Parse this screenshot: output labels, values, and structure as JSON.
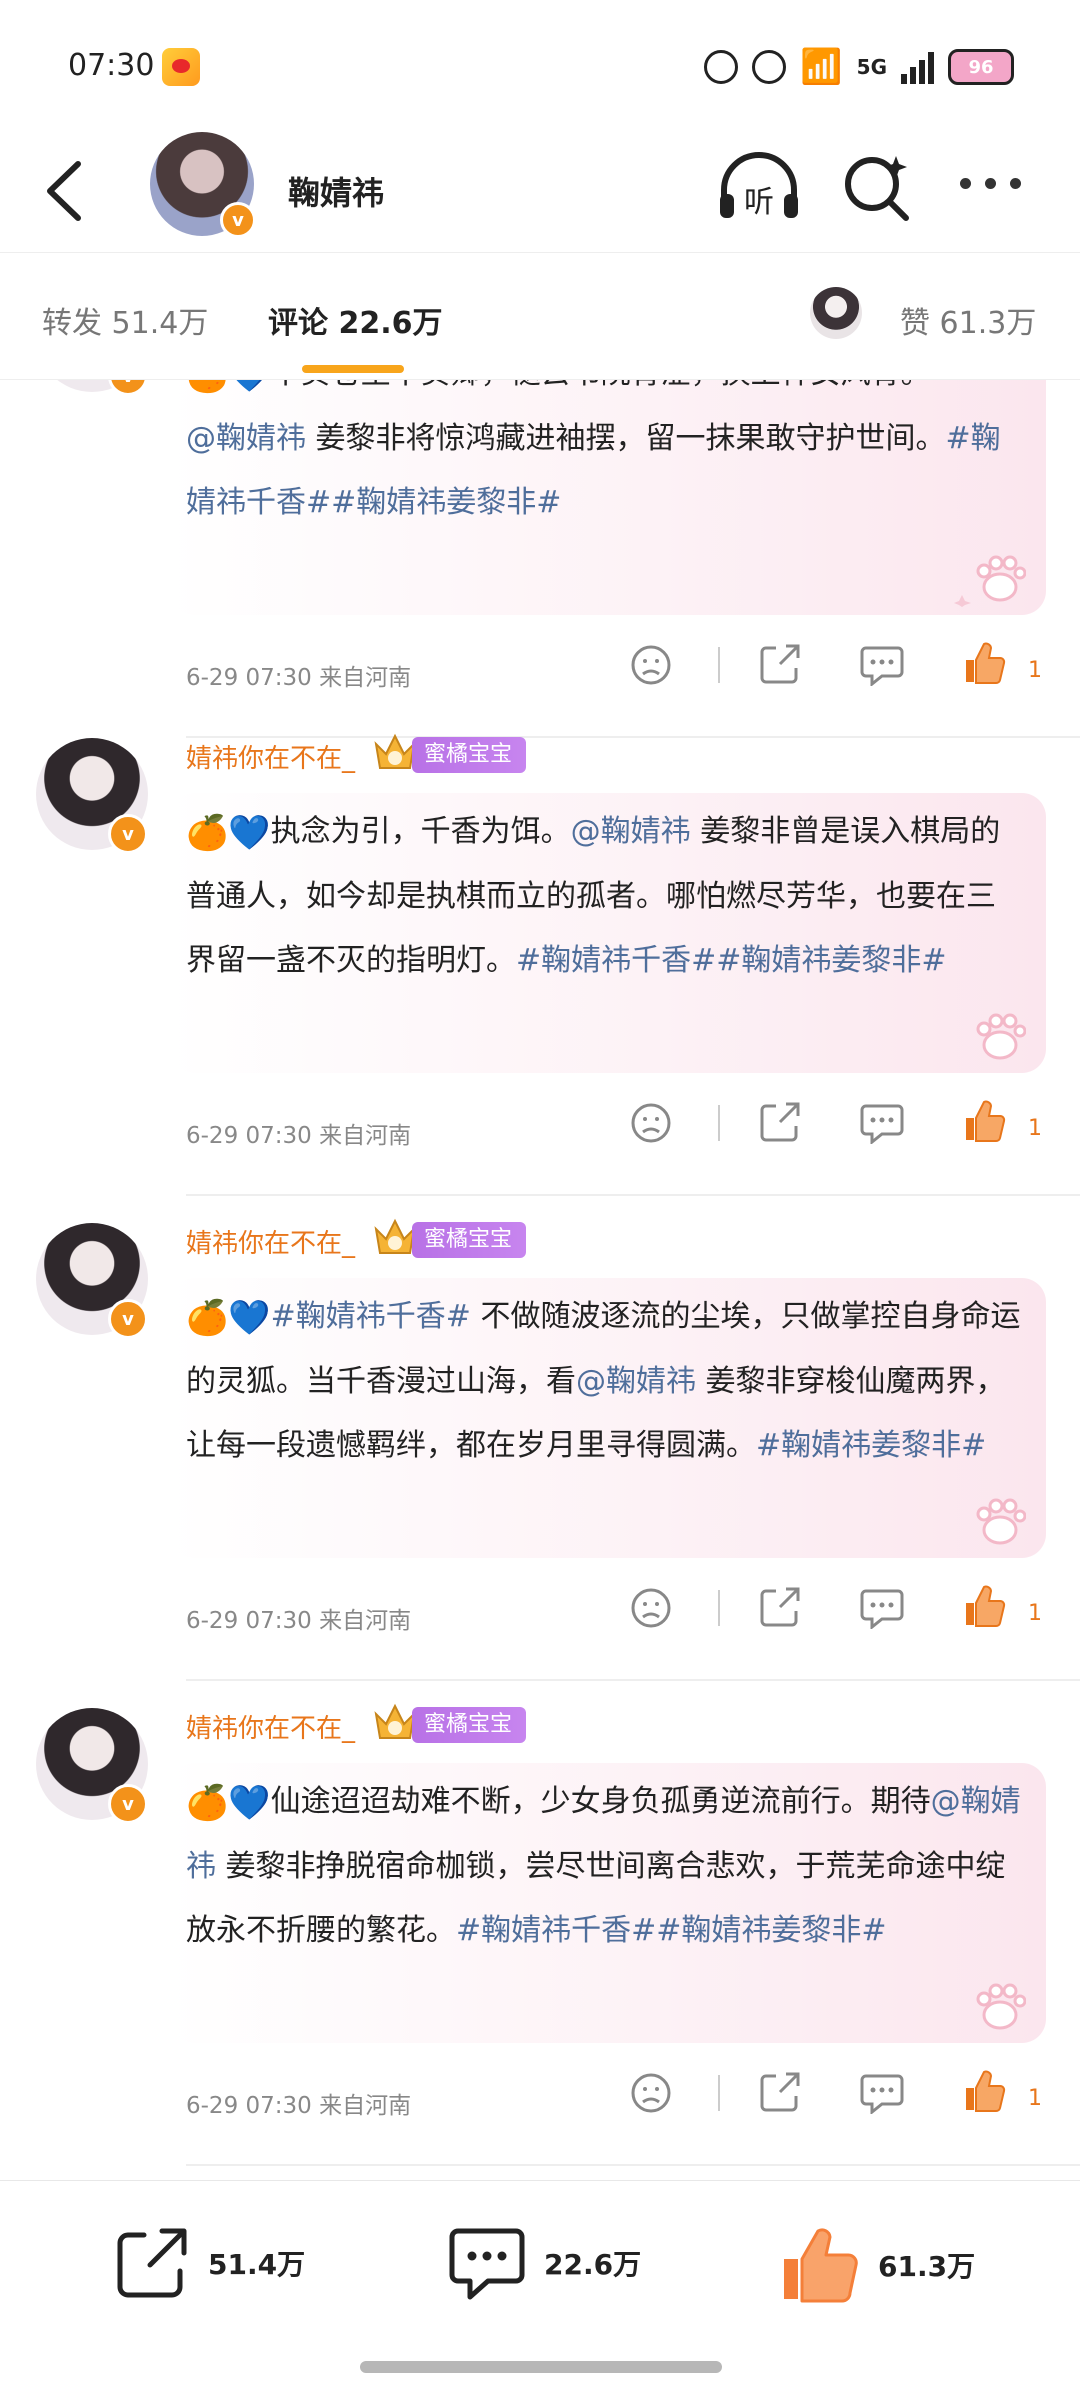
{
  "status": {
    "time": "07:30",
    "network": "5G",
    "battery": "96"
  },
  "header": {
    "name": "鞠婧祎",
    "listen_label": "听"
  },
  "tabs": {
    "repost": "转发 51.4万",
    "comment": "评论 22.6万",
    "like": "赞 61.3万"
  },
  "comments": [
    {
      "user": "",
      "tag": "",
      "emoji": "🍊💙",
      "parts": [
        {
          "text": "不负苍生不负卿，褪去书院青涩，换上神女风骨。",
          "link": false
        },
        {
          "text": "@鞠婧祎",
          "link": true
        },
        {
          "text": " 姜黎非将惊鸿藏进袖摆，留一抹果敢守护世间。",
          "link": false
        },
        {
          "text": "#鞠婧祎千香##鞠婧祎姜黎非#",
          "link": true
        }
      ],
      "time": "6-29 07:30",
      "location": "来自河南",
      "likes": "1"
    },
    {
      "user": "婧祎你在不在_",
      "tag": "蜜橘宝宝",
      "emoji": "🍊💙",
      "parts": [
        {
          "text": "执念为引，千香为饵。",
          "link": false
        },
        {
          "text": "@鞠婧祎",
          "link": true
        },
        {
          "text": " 姜黎非曾是误入棋局的普通人，如今却是执棋而立的孤者。哪怕燃尽芳华，也要在三界留一盏不灭的指明灯。",
          "link": false
        },
        {
          "text": "#鞠婧祎千香##鞠婧祎姜黎非#",
          "link": true
        }
      ],
      "time": "6-29 07:30",
      "location": "来自河南",
      "likes": "1"
    },
    {
      "user": "婧祎你在不在_",
      "tag": "蜜橘宝宝",
      "emoji": "🍊💙",
      "parts": [
        {
          "text": "#鞠婧祎千香#",
          "link": true
        },
        {
          "text": " 不做随波逐流的尘埃，只做掌控自身命运的灵狐。当千香漫过山海，看",
          "link": false
        },
        {
          "text": "@鞠婧祎",
          "link": true
        },
        {
          "text": " 姜黎非穿梭仙魔两界，让每一段遗憾羁绊，都在岁月里寻得圆满。",
          "link": false
        },
        {
          "text": "#鞠婧祎姜黎非#",
          "link": true
        }
      ],
      "time": "6-29 07:30",
      "location": "来自河南",
      "likes": "1"
    },
    {
      "user": "婧祎你在不在_",
      "tag": "蜜橘宝宝",
      "emoji": "🍊💙",
      "parts": [
        {
          "text": "仙途迢迢劫难不断，少女身负孤勇逆流前行。期待",
          "link": false
        },
        {
          "text": "@鞠婧祎",
          "link": true
        },
        {
          "text": " 姜黎非挣脱宿命枷锁，尝尽世间离合悲欢，于荒芜命途中绽放永不折腰的繁花。",
          "link": false
        },
        {
          "text": "#鞠婧祎千香##鞠婧祎姜黎非#",
          "link": true
        }
      ],
      "time": "6-29 07:30",
      "location": "来自河南",
      "likes": "1"
    }
  ],
  "bottom": {
    "reposts": "51.4万",
    "comments": "22.6万",
    "likes": "61.3万"
  },
  "colors": {
    "accent": "#f8a51b",
    "link": "#4f6e9b",
    "username": "#e8761b",
    "tag": "#b871e6"
  }
}
